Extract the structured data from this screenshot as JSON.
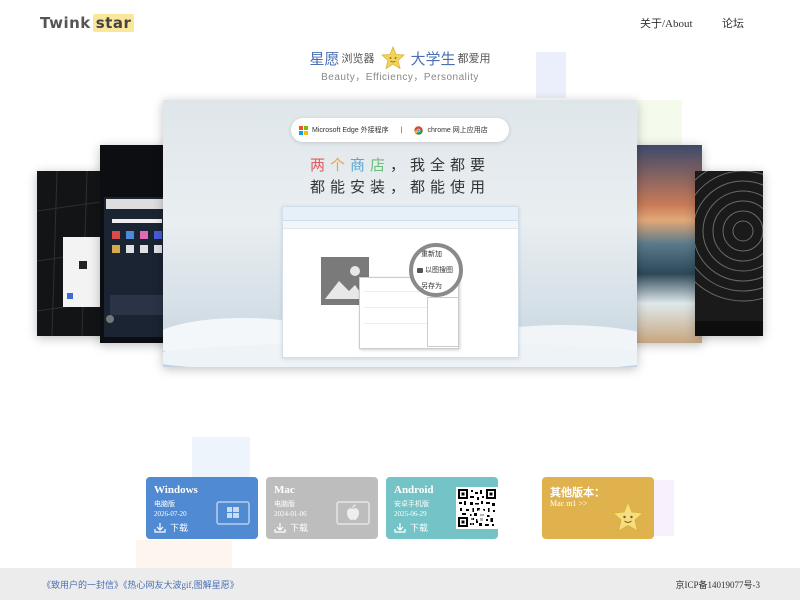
{
  "header": {
    "logo_text": "Twink",
    "logo_highlight": "star",
    "nav": [
      {
        "label": "关于/About"
      },
      {
        "label": "论坛"
      }
    ]
  },
  "tagline": {
    "part1": "星愿",
    "part2": "浏览器",
    "part3": "大学生",
    "part4": "都爱用",
    "subtitle": "Beauty，Efficiency，Personality"
  },
  "showcase": {
    "store_left": "Microsoft  Edge 外接程序",
    "store_sep": "|",
    "store_right": "chrome 网上应用店",
    "hero_line1_a": "两",
    "hero_line1_b": "个",
    "hero_line1_c": "商",
    "hero_line1_d": "店",
    "hero_line1_e": "，我全都要",
    "hero_line2": "都能安装，都能使用",
    "magnifier_items": [
      "重新加",
      "以图搜图",
      "另存为"
    ]
  },
  "downloads": [
    {
      "name": "Windows",
      "kind": "电脑版",
      "date": "2026-07-20",
      "button": "下载",
      "icon": "windows-icon"
    },
    {
      "name": "Mac",
      "kind": "电脑版",
      "date": "2024-01-06",
      "button": "下载",
      "icon": "apple-icon"
    },
    {
      "name": "Android",
      "kind": "安卓手机版",
      "date": "2025-06-29",
      "button": "下载",
      "icon": "android-icon"
    },
    {
      "name": "其他版本：",
      "link": "Mac m1 >>",
      "icon": "star-mascot-icon"
    }
  ],
  "footer": {
    "link1": "《致用户的一封信》",
    "link2": "《热心网友大波gif,图解星愿》",
    "icp": "京ICP备14019077号-3"
  },
  "colors": {
    "windows": "#4f8ad2",
    "mac": "#bdbdbd",
    "android": "#74c3c6",
    "other": "#e0b24e",
    "link": "#4a6fb5"
  }
}
